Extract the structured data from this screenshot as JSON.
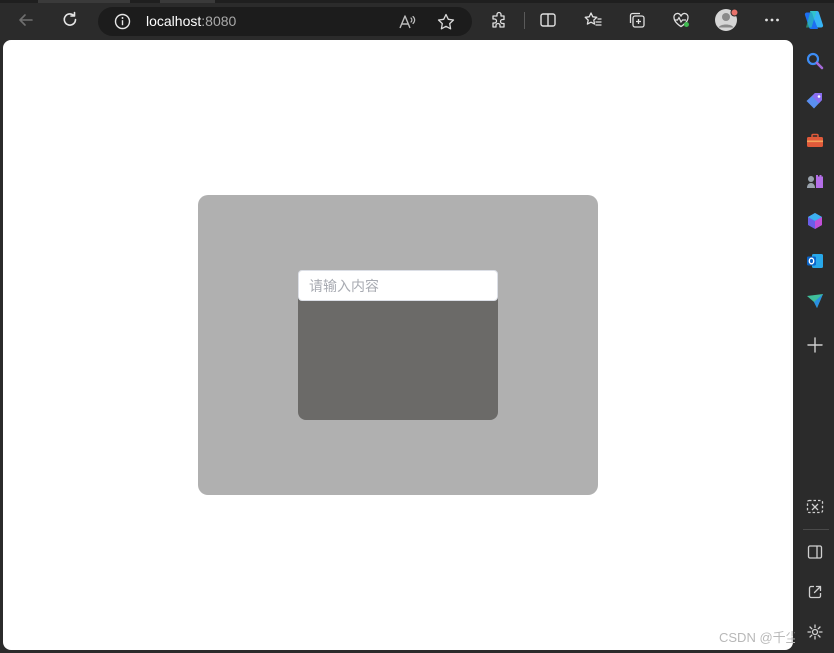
{
  "browser": {
    "url_host": "localhost",
    "url_port": ":8080",
    "nav": {
      "back_icon": "back-arrow-icon",
      "refresh_icon": "refresh-icon",
      "info_icon": "info-icon"
    },
    "toolbar_icons": [
      "read-aloud-icon",
      "favorite-star-icon",
      "extensions-icon",
      "split-screen-icon",
      "favorites-icon",
      "collections-icon",
      "browser-essentials-icon",
      "profile-avatar",
      "more-options-icon",
      "copilot-icon"
    ],
    "sidebar_icons": [
      "search-icon",
      "shopping-tag-icon",
      "tools-icon",
      "games-icon",
      "microsoft365-icon",
      "outlook-icon",
      "drop-icon",
      "add-icon",
      "screenshot-icon",
      "sidebar-toggle-icon",
      "open-external-icon",
      "settings-icon"
    ]
  },
  "page": {
    "search": {
      "value": "",
      "placeholder": "请输入内容"
    },
    "colors": {
      "outer_box": "#b0b0b0",
      "inner_box": "#6b6a68"
    }
  },
  "watermark": "CSDN @千尘星"
}
